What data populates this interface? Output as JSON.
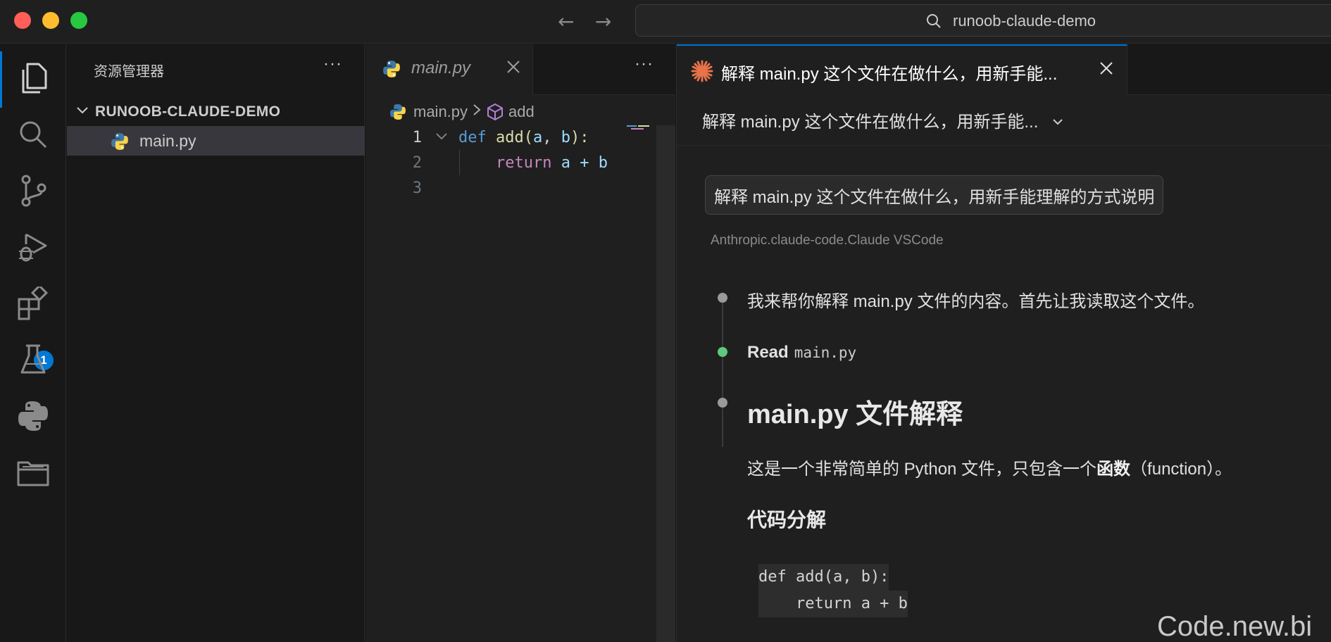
{
  "titlebar": {
    "search_text": "runoob-claude-demo"
  },
  "activity_bar": {
    "badge_count": "1",
    "items": [
      "explorer-icon",
      "search-icon",
      "source-control-icon",
      "run-debug-icon",
      "extensions-icon",
      "testing-icon",
      "python-icon",
      "folder-icon"
    ]
  },
  "sidebar": {
    "title": "资源管理器",
    "more": "···",
    "folder_name": "RUNOOB-CLAUDE-DEMO",
    "file_name": "main.py"
  },
  "editor": {
    "tab_label": "main.py",
    "more": "···",
    "breadcrumb_file": "main.py",
    "breadcrumb_symbol": "add",
    "lines": [
      {
        "number": "1",
        "def": "def",
        "fn": "add",
        "open": "(",
        "a": "a",
        "comma": ", ",
        "b": "b",
        "close": "):"
      },
      {
        "number": "2",
        "ret": "return",
        "expr": " a + b"
      },
      {
        "number": "3"
      }
    ]
  },
  "claude_panel": {
    "tab_title": "解释 main.py 这个文件在做什么，用新手能...",
    "session_title": "解释 main.py 这个文件在做什么，用新手能...",
    "user_message": "解释 main.py 这个文件在做什么，用新手能理解的方式说明",
    "meta": "Anthropic.claude-code.Claude VSCode",
    "assistant_intro": "我来帮你解释 main.py 文件的内容。首先让我读取这个文件。",
    "read_label": "Read",
    "read_file": "main.py",
    "heading": "main.py 文件解释",
    "para_before": "这是一个非常简单的 Python 文件，只包含一个",
    "para_bold": "函数",
    "para_after": "（function）。",
    "subheading": "代码分解",
    "code_lines": [
      "def add(a, b):",
      "    return a + b"
    ]
  },
  "watermark": "Code.new.bi",
  "colors": {
    "accent": "#0078d4",
    "claude_orange": "#e8734a",
    "status_green": "#5fc87f",
    "keyword_blue": "#569cd6",
    "function_yellow": "#dcdcaa",
    "param_blue": "#9cdcfe",
    "return_purple": "#c586c0"
  }
}
